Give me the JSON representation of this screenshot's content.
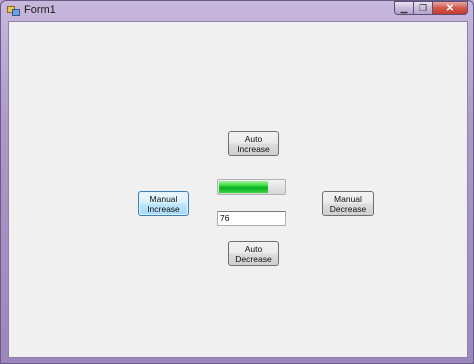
{
  "window": {
    "title": "Form1",
    "minimize_glyph": "▁",
    "maximize_glyph": "❐",
    "close_glyph": "✕"
  },
  "buttons": {
    "auto_increase": "Auto\nIncrease",
    "auto_decrease": "Auto\nDecrease",
    "manual_increase": "Manual\nIncrease",
    "manual_decrease": "Manual\nDecrease"
  },
  "progress": {
    "value": 76,
    "max": 100,
    "color": "#06b025"
  },
  "textbox": {
    "value": "76"
  }
}
